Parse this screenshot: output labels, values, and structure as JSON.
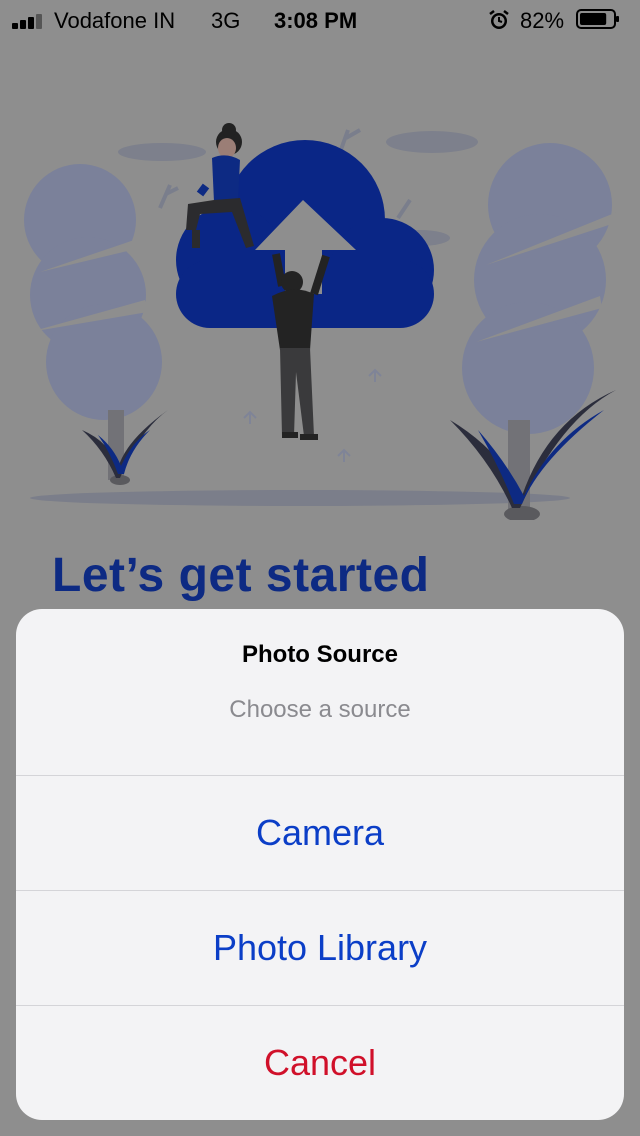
{
  "status_bar": {
    "carrier": "Vodafone IN",
    "network": "3G",
    "time": "3:08 PM",
    "battery_percent": "82%",
    "battery_level": 0.82,
    "signal_bars": 3,
    "icons": [
      "signal-bars-icon",
      "alarm-icon",
      "battery-icon"
    ]
  },
  "onboarding": {
    "headline": "Let’s get started",
    "illustration": "cloud-upload-illustration"
  },
  "action_sheet": {
    "title": "Photo Source",
    "subtitle": "Choose a source",
    "actions": [
      {
        "label": "Camera",
        "style": "default"
      },
      {
        "label": "Photo Library",
        "style": "default"
      },
      {
        "label": "Cancel",
        "style": "destructive"
      }
    ]
  },
  "colors": {
    "accent": "#0b3ec7",
    "destructive": "#d0102a",
    "brand": "#0d2a83",
    "dim_overlay": "#8e8e8e"
  }
}
